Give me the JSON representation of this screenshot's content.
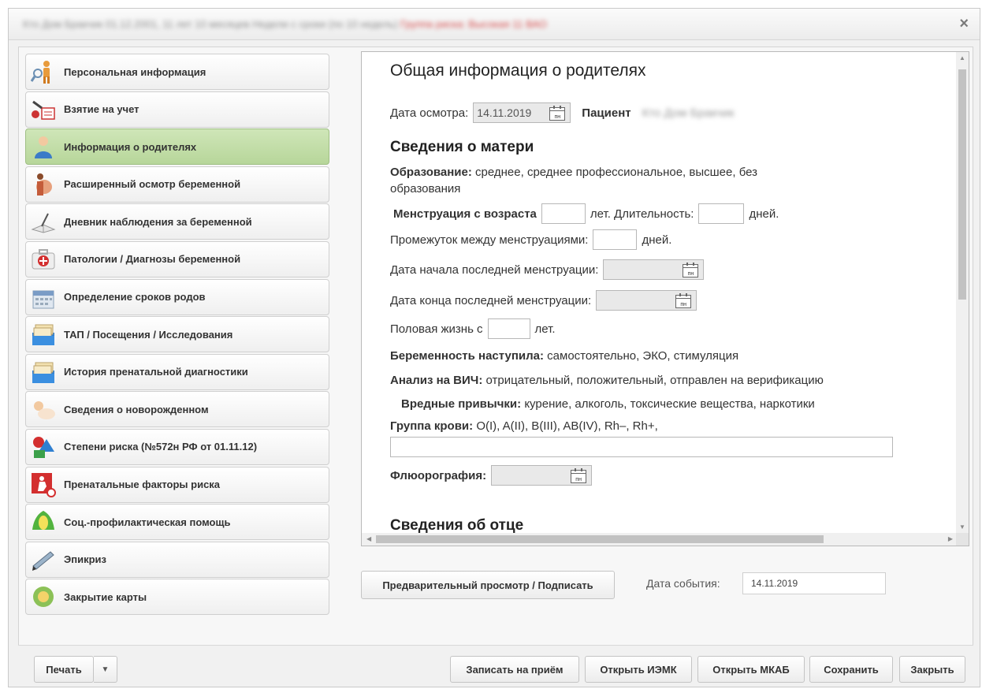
{
  "window": {
    "title_blurred": "Кто Дом Бракчик 01.12.2001, 11 лет 10 месяцев Недели с сроки (по 10 недель)",
    "title_red_blurred": "Группа риска: Высокая 11 ВАО"
  },
  "nav": {
    "items": [
      {
        "label": "Персональная информация",
        "icon": "person-magnifier-icon"
      },
      {
        "label": "Взятие на учет",
        "icon": "registration-icon"
      },
      {
        "label": "Информация о родителях",
        "icon": "parent-icon"
      },
      {
        "label": "Расширенный осмотр беременной",
        "icon": "pregnant-icon"
      },
      {
        "label": "Дневник наблюдения за беременной",
        "icon": "journal-icon"
      },
      {
        "label": "Патологии / Диагнозы беременной",
        "icon": "medkit-icon"
      },
      {
        "label": "Определение сроков родов",
        "icon": "calendar-icon"
      },
      {
        "label": "ТАП / Посещения / Исследования",
        "icon": "folders-icon"
      },
      {
        "label": "История пренатальной диагностики",
        "icon": "folders-icon"
      },
      {
        "label": "Сведения о новорожденном",
        "icon": "newborn-icon"
      },
      {
        "label": "Степени риска (№572н РФ от 01.11.12)",
        "icon": "risk-icon"
      },
      {
        "label": "Пренатальные факторы риска",
        "icon": "prenatal-risk-icon"
      },
      {
        "label": "Соц.-профилактическая помощь",
        "icon": "social-help-icon"
      },
      {
        "label": "Эпикриз",
        "icon": "pen-icon"
      },
      {
        "label": "Закрытие карты",
        "icon": "close-card-icon"
      }
    ],
    "active_index": 2
  },
  "form": {
    "title": "Общая информация о родителях",
    "exam_date_label": "Дата осмотра:",
    "exam_date_value": "14.11.2019",
    "patient_label": "Пациент",
    "patient_value_blurred": "Кто Дом Бракчик",
    "mother_heading": "Сведения о матери",
    "education_label": "Образование:",
    "education_options_1": "среднее, среднее профессиональное, высшее, без",
    "education_options_2": "образования",
    "menstruation_label": "Менструация с возраста",
    "years_unit": "лет.",
    "duration_label": "Длительность:",
    "days_unit": "дней.",
    "interval_label": "Промежуток между менструациями:",
    "last_start_label": "Дата начала последней менструации:",
    "last_end_label": "Дата конца последней менструации:",
    "sex_life_label": "Половая жизнь с",
    "pregnancy_label": "Беременность наступила:",
    "pregnancy_options": "самостоятельно, ЭКО, стимуляция",
    "hiv_label": "Анализ на ВИЧ:",
    "hiv_options": "отрицательный, положительный, отправлен на верификацию",
    "habits_label": "Вредные привычки:",
    "habits_options": "курение, алкоголь, токсические вещества, наркотики",
    "blood_label": "Группа крови:",
    "blood_options": "O(I), A(II), B(III), AB(IV), Rh–, Rh+,",
    "fluoro_label": "Флюорография:",
    "father_heading": "Сведения об отце",
    "cal_glyph": "пн"
  },
  "bottom": {
    "preview_button": "Предварительный просмотр / Подписать",
    "event_date_label": "Дата события:",
    "event_date_value": "14.11.2019"
  },
  "footer": {
    "print": "Печать",
    "schedule": "Записать на приём",
    "open_iemk": "Открыть ИЭМК",
    "open_mkab": "Открыть МКАБ",
    "save": "Сохранить",
    "close": "Закрыть"
  },
  "colors": {
    "active_nav": "#c3dea8",
    "title_red": "#d54b4b"
  }
}
